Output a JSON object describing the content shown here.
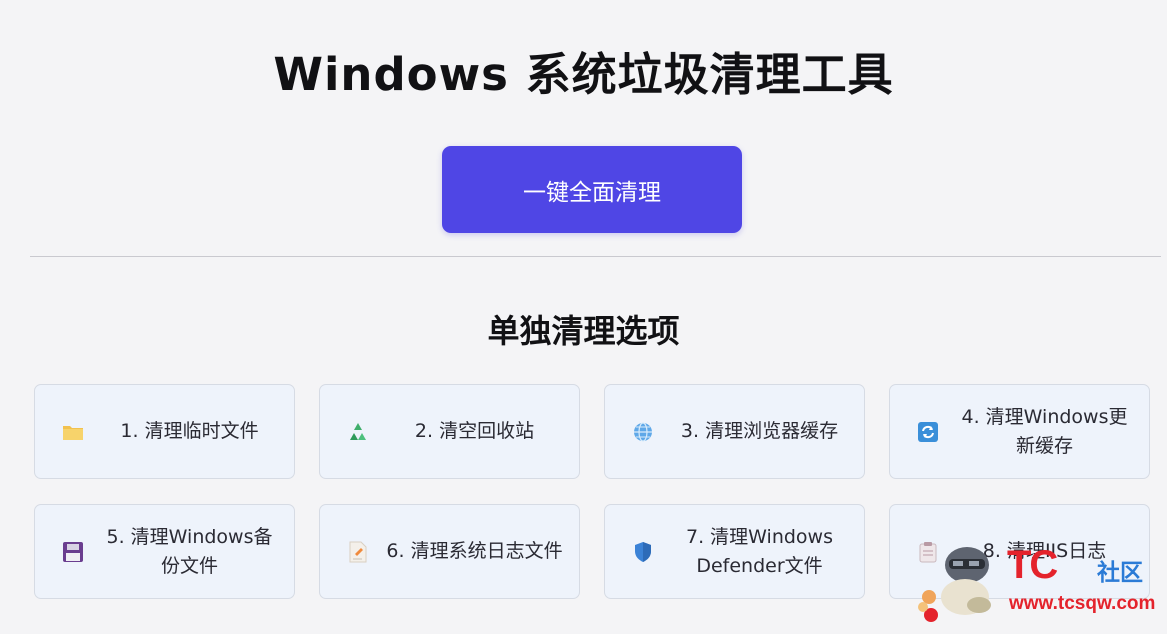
{
  "app": {
    "title": "Windows 系统垃圾清理工具",
    "clean_all_label": "一键全面清理",
    "section_title": "单独清理选项",
    "accent_color": "#4f46e5"
  },
  "options": [
    {
      "label": "1. 清理临时文件",
      "icon": "folder-icon"
    },
    {
      "label": "2. 清空回收站",
      "icon": "recycle-icon"
    },
    {
      "label": "3. 清理浏览器缓存",
      "icon": "globe-icon"
    },
    {
      "label": "4. 清理Windows更新缓存",
      "icon": "update-icon"
    },
    {
      "label": "5. 清理Windows备份文件",
      "icon": "floppy-disk-icon"
    },
    {
      "label": "6. 清理系统日志文件",
      "icon": "document-icon"
    },
    {
      "label": "7. 清理Windows Defender文件",
      "icon": "shield-icon"
    },
    {
      "label": "8. 清理IIS日志",
      "icon": "clipboard-icon"
    }
  ],
  "watermark": {
    "brand": "TC",
    "brand_suffix": "社区",
    "url": "www.tcsqw.com"
  }
}
